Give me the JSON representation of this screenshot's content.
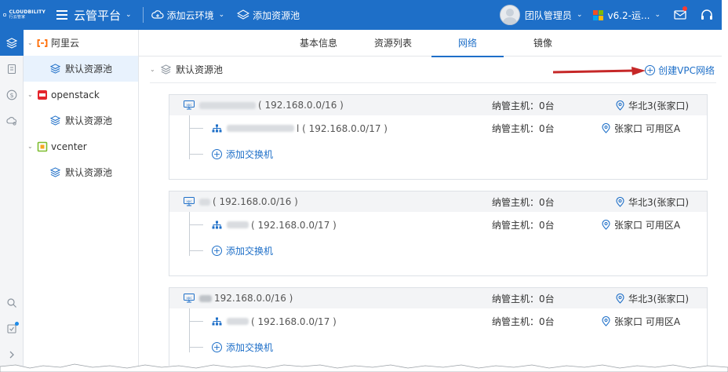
{
  "header": {
    "logo_text": "CLOUDBILITY",
    "logo_subtext": "行云管家",
    "platform": "云管平台",
    "add_env": "添加云环境",
    "add_pool": "添加资源池",
    "team": "团队管理员",
    "version": "v6.2-运...",
    "icons": [
      "menu-icon",
      "cloud-icon",
      "pool-icon",
      "chevron-down-icon",
      "message-icon",
      "headset-icon"
    ]
  },
  "rail": {
    "items": [
      "layers-icon",
      "document-icon",
      "dollar-icon",
      "cloud-gear-icon"
    ],
    "bottom": [
      "search-icon",
      "todo-icon",
      "chevron-right-icon"
    ]
  },
  "tree": {
    "providers": [
      {
        "name": "阿里云",
        "pool": "默认资源池",
        "color": "#ff6a00"
      },
      {
        "name": "openstack",
        "pool": "默认资源池",
        "color": "#e4252c"
      },
      {
        "name": "vcenter",
        "pool": "默认资源池",
        "color": "#7dbd2f"
      }
    ]
  },
  "tabs": [
    {
      "label": "基本信息",
      "active": false
    },
    {
      "label": "资源列表",
      "active": false
    },
    {
      "label": "网络",
      "active": true
    },
    {
      "label": "镜像",
      "active": false
    }
  ],
  "pool": {
    "name": "默认资源池",
    "create_vpc": "创建VPC网络"
  },
  "vpcs": [
    {
      "cidr": "( 192.168.0.0/16 )",
      "hosts": "纳管主机：0台",
      "region": "华北3(张家口)",
      "switch": {
        "cidr": "l ( 192.168.0.0/17 )",
        "hosts": "纳管主机：0台",
        "zone": "张家口 可用区A"
      },
      "add_switch": "添加交换机"
    },
    {
      "cidr": "( 192.168.0.0/16 )",
      "hosts": "纳管主机：0台",
      "region": "华北3(张家口)",
      "switch": {
        "cidr": "( 192.168.0.0/17 )",
        "hosts": "纳管主机：0台",
        "zone": "张家口 可用区A"
      },
      "add_switch": "添加交换机"
    },
    {
      "cidr": "192.168.0.0/16 )",
      "hosts": "纳管主机：0台",
      "region": "华北3(张家口)",
      "switch": {
        "cidr": "( 192.168.0.0/17 )",
        "hosts": "纳管主机：0台",
        "zone": "张家口 可用区A"
      },
      "add_switch": "添加交换机"
    }
  ],
  "colors": {
    "primary": "#1e6fc8",
    "arrow": "#c62828"
  }
}
